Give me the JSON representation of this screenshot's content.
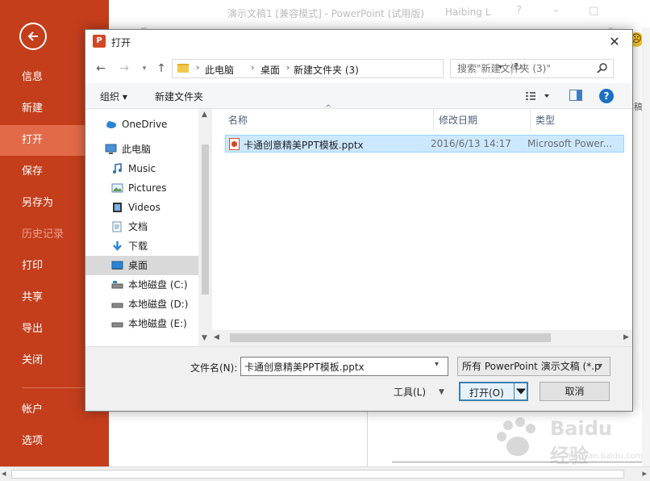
{
  "ppt": {
    "title": "演示文稿1 [兼容模式] - PowerPoint (试用版)",
    "user": "Haibing L",
    "help": "?",
    "minimize": "–",
    "restore": "□",
    "right_snippet": "文稿"
  },
  "backstage": {
    "items": [
      {
        "label": "信息"
      },
      {
        "label": "新建"
      },
      {
        "label": "打开"
      },
      {
        "label": "保存"
      },
      {
        "label": "另存为"
      },
      {
        "label": "历史记录"
      },
      {
        "label": "打印"
      },
      {
        "label": "共享"
      },
      {
        "label": "导出"
      },
      {
        "label": "关闭"
      },
      {
        "label": "帐户"
      },
      {
        "label": "选项"
      }
    ],
    "active_index": 2
  },
  "dialog": {
    "title": "打开",
    "app_icon": "P",
    "close": "✕",
    "breadcrumbs": [
      "此电脑",
      "桌面",
      "新建文件夹 (3)"
    ],
    "search_placeholder": "搜索\"新建文件夹 (3)\"",
    "toolbar": {
      "organize": "组织 ▾",
      "new_folder": "新建文件夹",
      "help": "?"
    },
    "nav_tree": [
      {
        "label": "OneDrive",
        "icon": "cloud-icon"
      },
      {
        "label": "此电脑",
        "icon": "computer-icon"
      },
      {
        "label": "Music",
        "icon": "music-icon"
      },
      {
        "label": "Pictures",
        "icon": "pictures-icon"
      },
      {
        "label": "Videos",
        "icon": "videos-icon"
      },
      {
        "label": "文档",
        "icon": "documents-icon"
      },
      {
        "label": "下载",
        "icon": "download-icon"
      },
      {
        "label": "桌面",
        "icon": "desktop-icon"
      },
      {
        "label": "本地磁盘 (C:)",
        "icon": "drive-icon"
      },
      {
        "label": "本地磁盘 (D:)",
        "icon": "drive-icon"
      },
      {
        "label": "本地磁盘 (E:)",
        "icon": "drive-icon"
      }
    ],
    "columns": [
      "名称",
      "修改日期",
      "类型"
    ],
    "files": [
      {
        "name": "卡通创意精美PPT模板.pptx",
        "modified": "2016/6/13 14:17",
        "type": "Microsoft Power..."
      }
    ],
    "filename_label": "文件名(N):",
    "filename_value": "卡通创意精美PPT模板.pptx",
    "filetype_value": "所有 PowerPoint 演示文稿 (*.p",
    "tools_label": "工具(L)",
    "open_label": "打开(O)",
    "cancel_label": "取消"
  },
  "watermark": {
    "text": "Baidu 经验",
    "sub": "jingyan.baidu.com"
  },
  "colors": {
    "backstage": "#c43e1c",
    "backstage_active": "#e36a48",
    "selection": "#cce8ff"
  }
}
